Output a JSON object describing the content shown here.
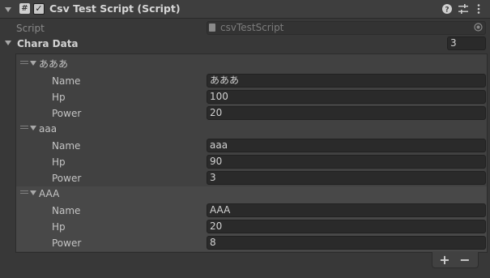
{
  "component": {
    "title": "Csv Test Script (Script)",
    "enabled": true,
    "icons": [
      "help-icon",
      "presets-icon",
      "more-icon"
    ]
  },
  "script": {
    "label": "Script",
    "value": "csvTestScript"
  },
  "list": {
    "label": "Chara Data",
    "size": "3",
    "elements": [
      {
        "header": "あああ",
        "fields": [
          {
            "label": "Name",
            "value": "あああ"
          },
          {
            "label": "Hp",
            "value": "100"
          },
          {
            "label": "Power",
            "value": "20"
          }
        ]
      },
      {
        "header": "aaa",
        "fields": [
          {
            "label": "Name",
            "value": "aaa"
          },
          {
            "label": "Hp",
            "value": "90"
          },
          {
            "label": "Power",
            "value": "3"
          }
        ]
      },
      {
        "header": "AAA",
        "fields": [
          {
            "label": "Name",
            "value": "AAA"
          },
          {
            "label": "Hp",
            "value": "20"
          },
          {
            "label": "Power",
            "value": "8"
          }
        ]
      }
    ],
    "add_label": "+",
    "remove_label": "−"
  }
}
